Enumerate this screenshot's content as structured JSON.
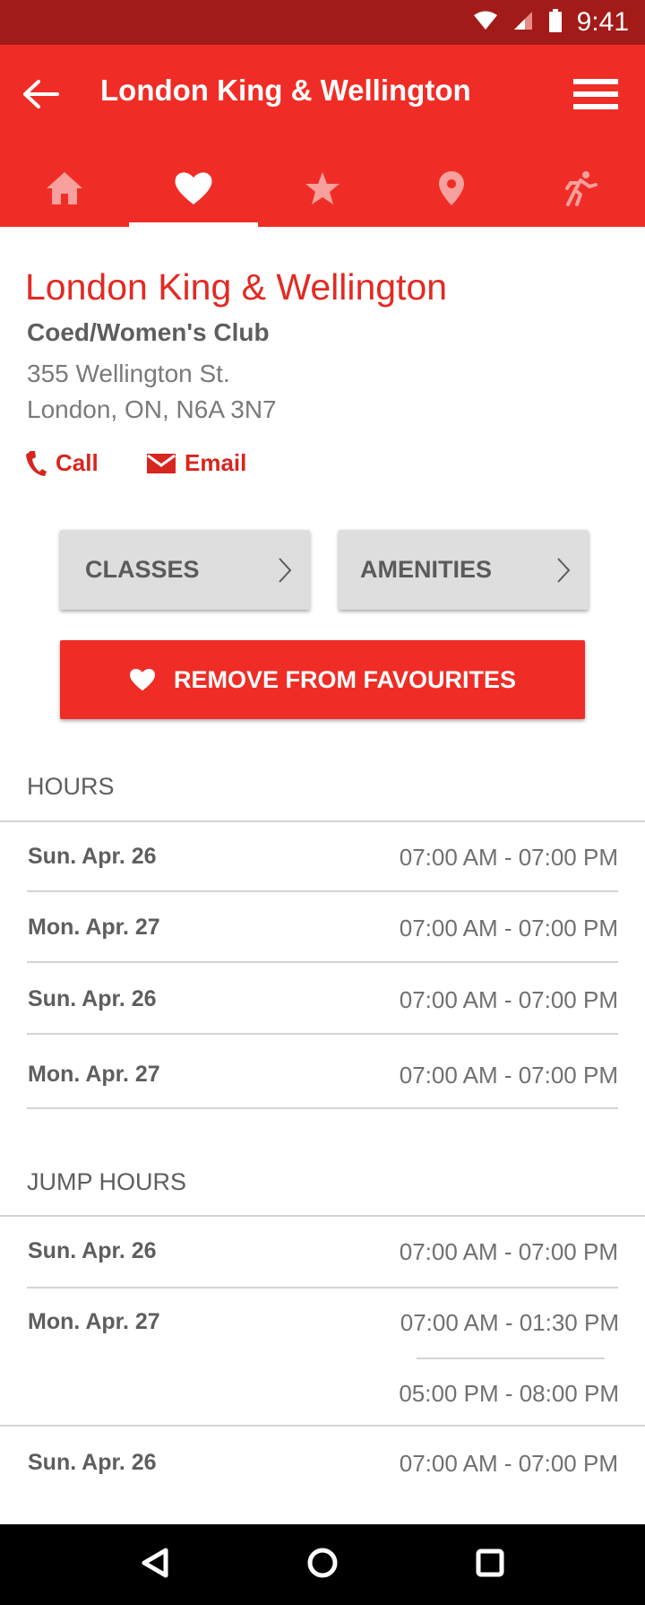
{
  "status": {
    "time": "9:41"
  },
  "appbar": {
    "title": "London King & Wellington",
    "tabs": [
      {
        "name": "home",
        "icon": "home-icon"
      },
      {
        "name": "favourites",
        "icon": "heart-icon",
        "active": true
      },
      {
        "name": "featured",
        "icon": "star-icon"
      },
      {
        "name": "location",
        "icon": "map-pin-icon"
      },
      {
        "name": "activity",
        "icon": "runner-icon"
      }
    ]
  },
  "club": {
    "name": "London King & Wellington",
    "type": "Coed/Women's Club",
    "address_line1": "355 Wellington St.",
    "address_line2": "London, ON, N6A 3N7",
    "call_label": "Call",
    "email_label": "Email"
  },
  "buttons": {
    "classes": "CLASSES",
    "amenities": "AMENITIES",
    "favourite": "REMOVE FROM FAVOURITES"
  },
  "hours": {
    "title": "HOURS",
    "rows": [
      {
        "day": "Sun. Apr. 26",
        "time": "07:00 AM - 07:00 PM"
      },
      {
        "day": "Mon. Apr. 27",
        "time": "07:00 AM - 07:00 PM"
      },
      {
        "day": "Sun. Apr. 26",
        "time": "07:00 AM - 07:00 PM"
      },
      {
        "day": "Mon. Apr. 27",
        "time": "07:00 AM - 07:00 PM"
      }
    ]
  },
  "jump_hours": {
    "title": "JUMP HOURS",
    "rows": [
      {
        "day": "Sun. Apr. 26",
        "time": "07:00 AM - 07:00 PM"
      },
      {
        "day": "Mon. Apr. 27",
        "time": "07:00 AM - 01:30 PM",
        "time2": "05:00 PM - 08:00 PM"
      },
      {
        "day": "Sun. Apr. 26",
        "time": "07:00 AM - 07:00 PM"
      }
    ]
  },
  "colors": {
    "primary": "#ef2d26",
    "primary_dark": "#a31b18",
    "accent_text": "#e22a23",
    "button_grey": "#dedede"
  }
}
